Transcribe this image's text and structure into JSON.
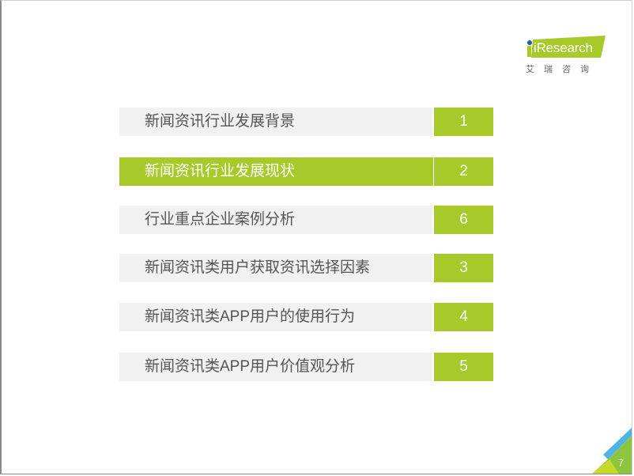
{
  "logo": {
    "brand": "iResearch",
    "subtitle": "艾瑞咨询",
    "colors": {
      "green": "#a8c92a",
      "dot": "#1e5fa8"
    }
  },
  "toc": {
    "items": [
      {
        "label": "新闻资讯行业发展背景",
        "number": "1",
        "active": false
      },
      {
        "label": "新闻资讯行业发展现状",
        "number": "2",
        "active": true
      },
      {
        "label": "行业重点企业案例分析",
        "number": "6",
        "active": false
      },
      {
        "label": "新闻资讯类用户获取资讯选择因素",
        "number": "3",
        "active": false
      },
      {
        "label": "新闻资讯类APP用户的使用行为",
        "number": "4",
        "active": false
      },
      {
        "label": "新闻资讯类APP用户价值观分析",
        "number": "5",
        "active": false
      }
    ],
    "colors": {
      "accent": "#a8c92a",
      "inactive_bg": "#f1f1f1",
      "inactive_text": "#555555"
    }
  },
  "footer": {
    "page_number": "7",
    "colors": {
      "blue": "#4fb3e8",
      "green": "#a8c92a",
      "yellow_green": "#c9d92a"
    }
  }
}
